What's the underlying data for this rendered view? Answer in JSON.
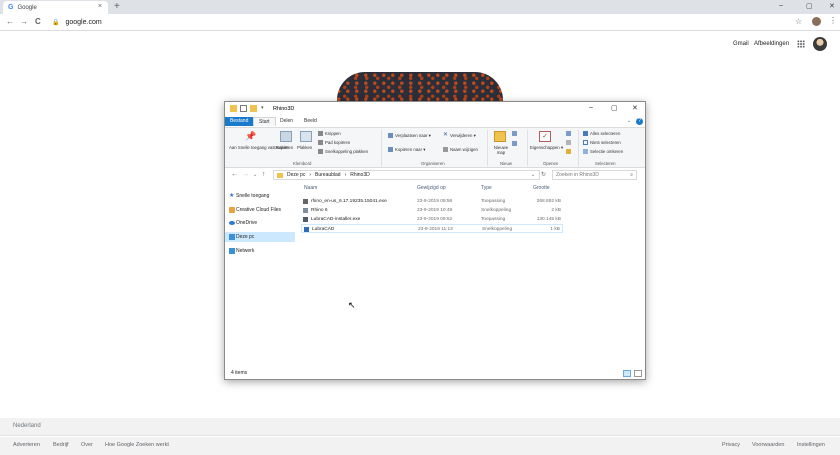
{
  "browser": {
    "tab_title": "Google",
    "tab_close": "×",
    "new_tab": "+",
    "url": "google.com",
    "window_controls": [
      "–",
      "▢",
      "✕"
    ],
    "nav": {
      "back": "←",
      "forward": "→",
      "reload": "C",
      "lock": "🔒",
      "star": "☆",
      "menu": "⋮"
    }
  },
  "google": {
    "header": {
      "gmail": "Gmail",
      "images": "Afbeeldingen"
    },
    "footer": {
      "country": "Nederland",
      "left_links": [
        "Adverteren",
        "Bedrijf",
        "Over",
        "Hoe Google Zoeken werkt"
      ],
      "right_links": [
        "Privacy",
        "Voorwaarden",
        "Instellingen"
      ]
    }
  },
  "explorer": {
    "title": "Rhino3D",
    "controls": [
      "–",
      "▢",
      "✕"
    ],
    "ribbon_tabs": [
      "Bestand",
      "Start",
      "Delen",
      "Beeld"
    ],
    "ribbon": {
      "pin": "Aan Snelle toegang vastmaken",
      "copy": "Kopiëren",
      "paste": "Plakken",
      "cut": "Knippen",
      "copy_path": "Pad kopiëren",
      "paste_shortcut": "Snelkoppeling plakken",
      "move_to": "Verplaatsen naar ▾",
      "copy_to": "Kopiëren naar ▾",
      "delete": "Verwijderen ▾",
      "rename": "Naam wijzigen",
      "new_folder": "Nieuwe map",
      "properties": "Eigenschappen ▾",
      "select_all": "Alles selecteren",
      "select_none": "Niets selecteren",
      "invert": "Selectie omkeren",
      "groups": [
        "Klembord",
        "Organiseren",
        "Nieuw",
        "Openen",
        "Selecteren"
      ]
    },
    "address": [
      "Deze pc",
      "›",
      "Bureaublad",
      "›",
      "Rhino3D"
    ],
    "search_placeholder": "Zoeken in Rhino3D",
    "sidebar": [
      "Snelle toegang",
      "Creative Cloud Files",
      "OneDrive",
      "Deze pc",
      "Netwerk"
    ],
    "columns": [
      "Naam",
      "Gewijzigd op",
      "Type",
      "Grootte"
    ],
    "files": [
      {
        "name": "rhino_en-us_6.17.19235.15041.exe",
        "date": "23-9-2019 09:58",
        "type": "Toepassing",
        "size": "268.892 kB"
      },
      {
        "name": "Rhino 6",
        "date": "23-9-2019 10:49",
        "type": "Snelkoppeling",
        "size": "2 kB"
      },
      {
        "name": "LubraCAD-installer.exe",
        "date": "23-9-2019 09:52",
        "type": "Toepassing",
        "size": "130.145 kB"
      },
      {
        "name": "LubraCAD",
        "date": "23-9-2019 11:13",
        "type": "Snelkoppeling",
        "size": "1 kB"
      }
    ],
    "status": "4 items"
  },
  "colors": {
    "accent": "#1979ca",
    "selected": "#cce8ff"
  }
}
